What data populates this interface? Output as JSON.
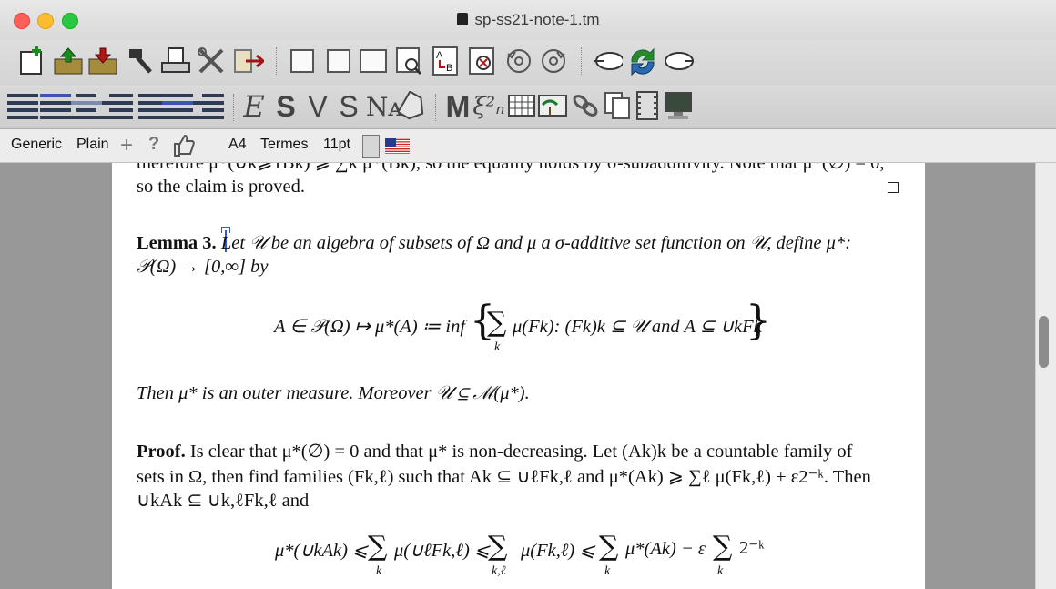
{
  "window": {
    "title": "sp-ss21-note-1.tm"
  },
  "formatbar": {
    "style": "Generic",
    "mode": "Plain",
    "paper": "A4",
    "font": "Termes",
    "size": "11pt"
  },
  "document": {
    "top_fragment": "therefore μ*(∪k⩾1Bk) ⩾ ∑k μ*(Bk), so the equality holds by σ-subadditivity. Note that μ*(∅) = 0,",
    "proved_line": "so the claim is proved.",
    "lemma_label": "Lemma 3.",
    "lemma_line1": "Let 𝒰 be an algebra of subsets of Ω and μ a σ-additive set function on 𝒰, define μ*:",
    "lemma_line2": "𝒫(Ω) → [0,∞] by",
    "eq1_lhs": "A ∈ 𝒫(Ω) ↦ μ*(A) ≔ inf",
    "eq1_inner": "μ(Fk): (Fk)k ⊆ 𝒰 and A ⊆ ∪kFk",
    "eq1_sub": "k",
    "then_line": "Then μ* is an outer measure. Moreover 𝒰 ⊆ ℳ(μ*).",
    "proof_label": "Proof.",
    "proof_line1": "Is clear that μ*(∅) = 0 and that μ* is non-decreasing. Let (Ak)k be a countable family of",
    "proof_line2": "sets in Ω, then find families (Fk,ℓ) such that Ak ⊆ ∪ℓFk,ℓ and μ*(Ak) ⩾ ∑ℓ μ(Fk,ℓ) + ε2⁻ᵏ. Then",
    "proof_line3": "∪kAk ⊆ ∪k,ℓFk,ℓ and",
    "eq2_t1": "μ*(∪kAk) ⩽",
    "eq2_t2": "μ(∪ℓFk,ℓ) ⩽",
    "eq2_t3": "μ(Fk,ℓ) ⩽",
    "eq2_t4": "μ*(Ak) − ε",
    "eq2_t5": "2⁻ᵏ",
    "eq2_s1": "k",
    "eq2_s2": "k,ℓ",
    "eq2_s3": "k",
    "eq2_s4": "k"
  },
  "toolbar2_letters": {
    "e": "E",
    "s": "S",
    "v": "V",
    "s2": "S",
    "na": "Nᴀ",
    "m": "M",
    "xi": "ξ²ₙ"
  },
  "icons": [
    "new-document-icon",
    "open-icon",
    "save-icon",
    "build-icon",
    "print-icon",
    "preferences-icon",
    "exit-icon",
    "page-layout-icon",
    "zoom-icon",
    "spell-check-icon",
    "undo-icon",
    "redo-icon",
    "back-icon",
    "refresh-icon",
    "forward-icon"
  ]
}
